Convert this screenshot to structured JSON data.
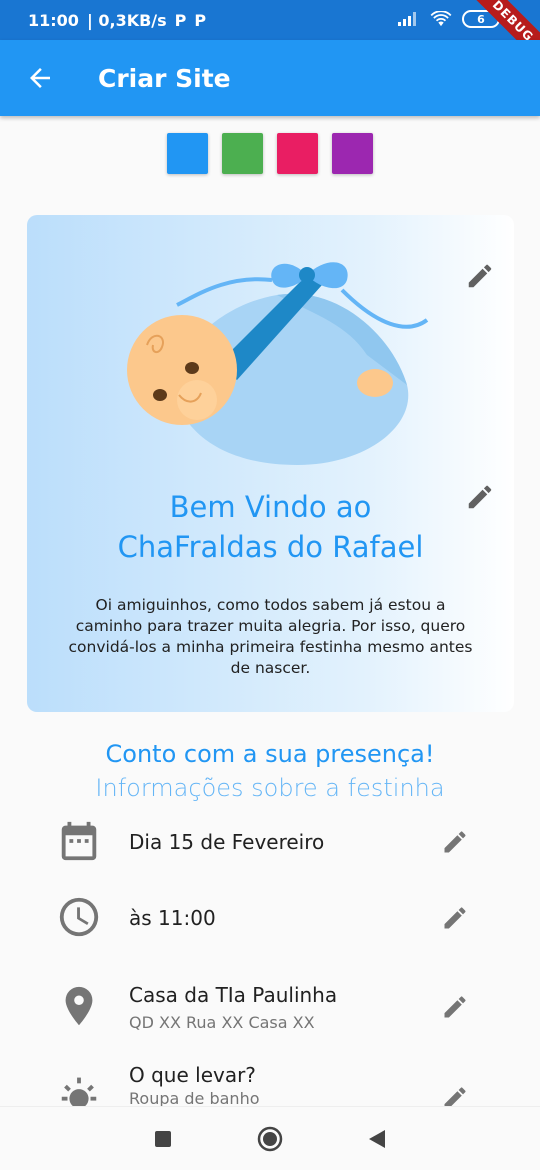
{
  "status_bar": {
    "time": "11:00",
    "network_speed": "| 0,3KB/s",
    "battery": "6"
  },
  "debug_banner": "DEBUG",
  "app_bar": {
    "title": "Criar Site",
    "back_icon": "arrow-back-icon"
  },
  "theme_colors": [
    {
      "name": "blue",
      "hex": "#2196f3"
    },
    {
      "name": "green",
      "hex": "#4caf50"
    },
    {
      "name": "pink",
      "hex": "#e91e63"
    },
    {
      "name": "purple",
      "hex": "#9c27b0"
    }
  ],
  "card": {
    "title_line1": "Bem Vindo ao",
    "title_line2": "ChaFraldas do Rafael",
    "message": "Oi amiguinhos, como todos sabem já estou a caminho para trazer muita alegria. Por isso, quero convidá-los a minha primeira festinha mesmo antes de nascer."
  },
  "section": {
    "heading": "Conto com a sua presença!",
    "subheading": "Informações sobre a festinha"
  },
  "info": {
    "date": {
      "title": "Dia 15 de Fevereiro",
      "icon": "calendar-icon"
    },
    "time": {
      "title": "às 11:00",
      "icon": "clock-icon"
    },
    "place": {
      "title": "Casa da TIa Paulinha",
      "subtitle": "QD XX Rua XX Casa XX",
      "icon": "location-pin-icon"
    },
    "bring": {
      "title": "O que levar?",
      "subtitle": "Roupa de banho",
      "icon": "sun-icon"
    }
  },
  "nav_bar": [
    "recents-icon",
    "home-icon",
    "back-triangle-icon"
  ]
}
